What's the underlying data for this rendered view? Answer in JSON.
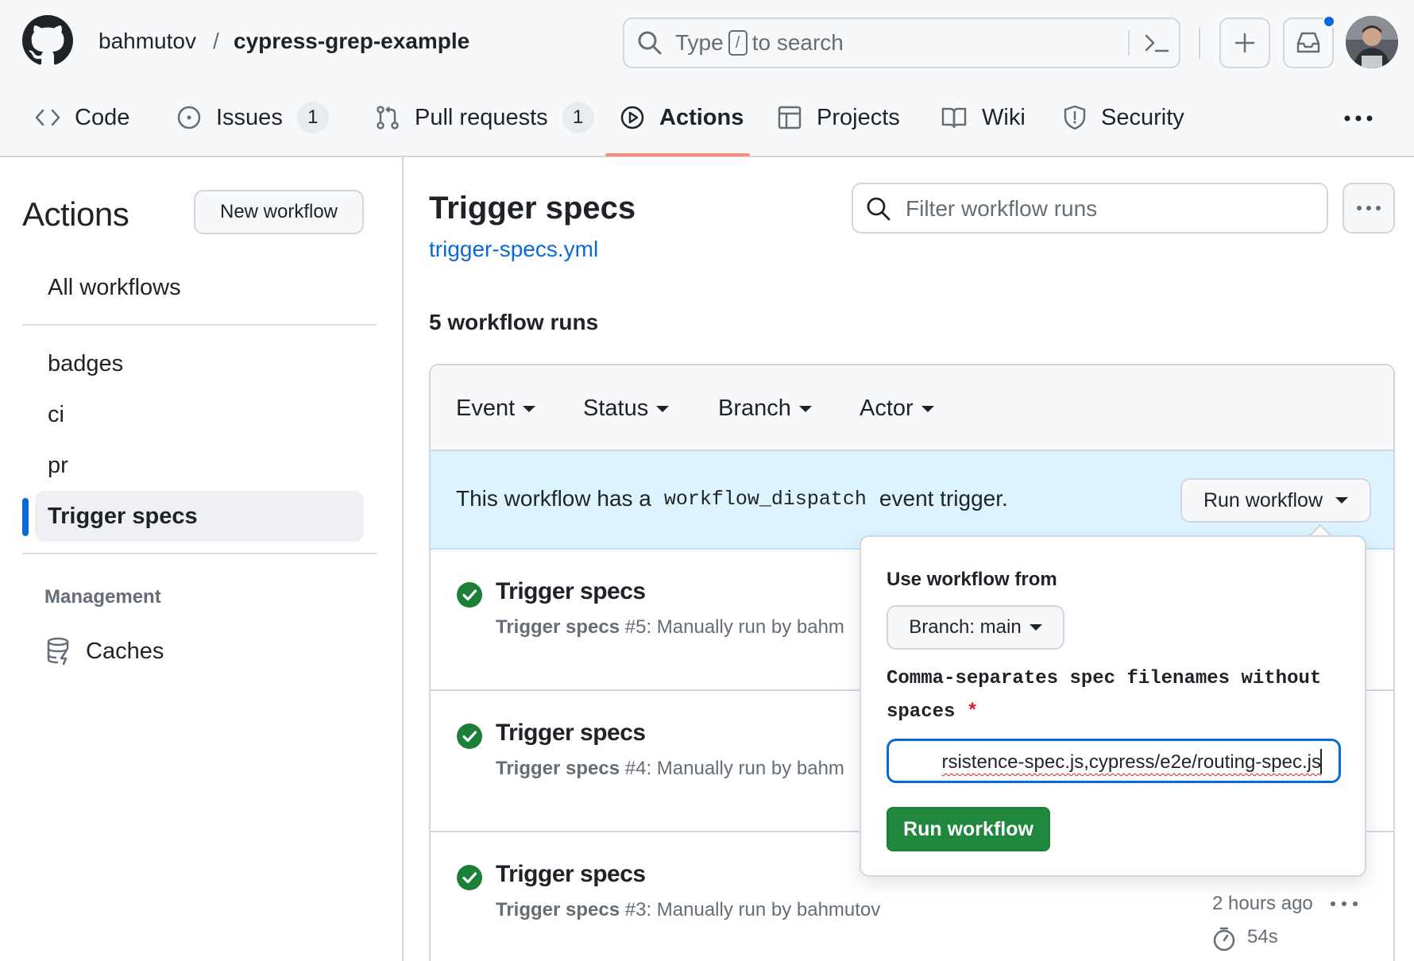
{
  "header": {
    "owner": "bahmutov",
    "separator": "/",
    "repo": "cypress-grep-example",
    "search": {
      "prefix": "Type",
      "key": "/",
      "suffix": "to search"
    }
  },
  "nav": {
    "items": [
      {
        "label": "Code",
        "icon": "code-icon"
      },
      {
        "label": "Issues",
        "icon": "issue-icon",
        "count": "1"
      },
      {
        "label": "Pull requests",
        "icon": "pull-request-icon",
        "count": "1"
      },
      {
        "label": "Actions",
        "icon": "play-icon",
        "active": true
      },
      {
        "label": "Projects",
        "icon": "table-icon"
      },
      {
        "label": "Wiki",
        "icon": "book-icon"
      },
      {
        "label": "Security",
        "icon": "shield-icon"
      }
    ],
    "active_color": "#fd8c73"
  },
  "sidebar": {
    "title": "Actions",
    "new_workflow": "New workflow",
    "all_workflows": "All workflows",
    "workflows": [
      "badges",
      "ci",
      "pr",
      "Trigger specs"
    ],
    "active_workflow": "Trigger specs",
    "management_heading": "Management",
    "caches": "Caches"
  },
  "main": {
    "title": "Trigger specs",
    "file": "trigger-specs.yml",
    "filter_placeholder": "Filter workflow runs",
    "runs_count": "5 workflow runs",
    "filters": [
      "Event",
      "Status",
      "Branch",
      "Actor"
    ],
    "dispatch": {
      "before": "This workflow has a",
      "code": "workflow_dispatch",
      "after": "event trigger.",
      "button": "Run workflow"
    },
    "runs": [
      {
        "title": "Trigger specs",
        "name": "Trigger specs",
        "number": "#5",
        "desc": ": Manually run by bahm",
        "status": "success"
      },
      {
        "title": "Trigger specs",
        "name": "Trigger specs",
        "number": "#4",
        "desc": ": Manually run by bahm",
        "status": "success"
      },
      {
        "title": "Trigger specs",
        "name": "Trigger specs",
        "number": "#3",
        "desc": ": Manually run by bahmutov",
        "status": "success",
        "time": "2 hours ago",
        "duration": "54s"
      }
    ]
  },
  "popover": {
    "use_from": "Use workflow from",
    "branch": "Branch: main",
    "input_label": "Comma-separates spec filenames without spaces",
    "required_mark": "*",
    "input_value": "rsistence-spec.js,cypress/e2e/routing-spec.js",
    "submit": "Run workflow"
  },
  "colors": {
    "accent": "#0969da",
    "success": "#1a7f37",
    "primary_button": "#1f883d",
    "dispatch_bg": "#ddf4ff"
  }
}
